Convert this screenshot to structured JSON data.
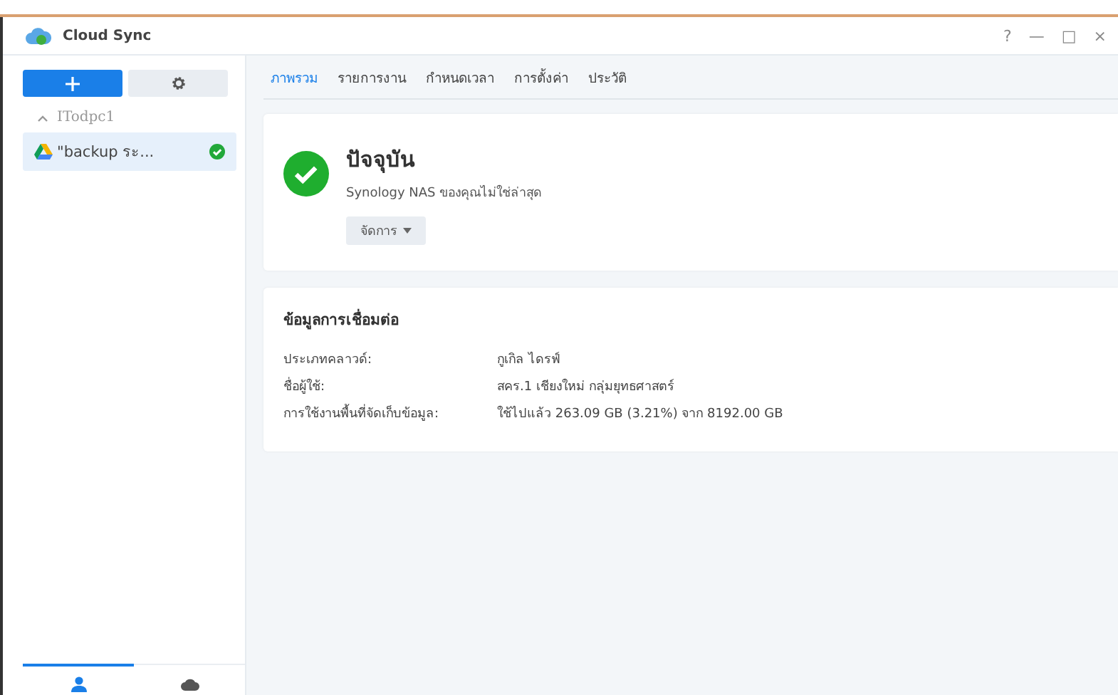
{
  "window": {
    "title": "Cloud Sync",
    "controls": [
      "?",
      "—",
      "□",
      "×"
    ]
  },
  "sidebar": {
    "tree": [
      {
        "label": "ITodpc1",
        "expanded": true,
        "children": [
          {
            "label": "\"backup ระ...",
            "selected": true,
            "synced": true
          }
        ]
      }
    ],
    "bottom_tabs": [
      {
        "kind": "user",
        "selected": true
      },
      {
        "kind": "cloud",
        "selected": false
      }
    ]
  },
  "tabs": [
    {
      "label": "ภาพรวม",
      "selected": true
    },
    {
      "label": "รายการงาน",
      "selected": false
    },
    {
      "label": "กำหนดเวลา",
      "selected": false
    },
    {
      "label": "การตั้งค่า",
      "selected": false
    },
    {
      "label": "ประวัติ",
      "selected": false
    }
  ],
  "status_card": {
    "up_to_date": true,
    "title": "ปัจจุบัน",
    "message": "Synology NAS ของคุณไม่ใช่ล่าสุด",
    "button": "จัดการ"
  },
  "connection": {
    "title": "ข้อมูลการเชื่อมต่อ",
    "rows": [
      {
        "label": "ประเภทคลาวด์:",
        "value": "กูเกิล ไดรฟ์"
      },
      {
        "label": "ชื่อผู้ใช้:",
        "value": "สคร.1 เชียงใหม่ กลุ่มยุทธศาสตร์"
      },
      {
        "label": "การใช้งานพื้นที่จัดเก็บข้อมูล:",
        "value": "ใช้ไปแล้ว 263.09 GB (3.21%) จาก 8192.00 GB"
      }
    ]
  }
}
